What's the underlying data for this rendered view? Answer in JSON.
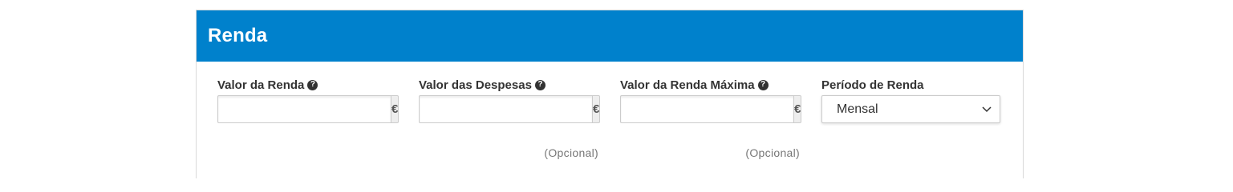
{
  "panel": {
    "title": "Renda",
    "header_color": "#0081cc"
  },
  "fields": {
    "rent_value": {
      "label": "Valor da Renda",
      "value": "",
      "currency": "€",
      "help_icon": "question-circle-icon"
    },
    "expenses_value": {
      "label": "Valor das Despesas",
      "value": "",
      "currency": "€",
      "optional_text": "(Opcional)",
      "help_icon": "question-circle-icon"
    },
    "max_rent_value": {
      "label": "Valor da Renda Máxima",
      "value": "",
      "currency": "€",
      "optional_text": "(Opcional)",
      "help_icon": "question-circle-icon"
    },
    "rent_period": {
      "label": "Período de Renda",
      "selected": "Mensal",
      "icon": "chevron-down-icon"
    }
  }
}
